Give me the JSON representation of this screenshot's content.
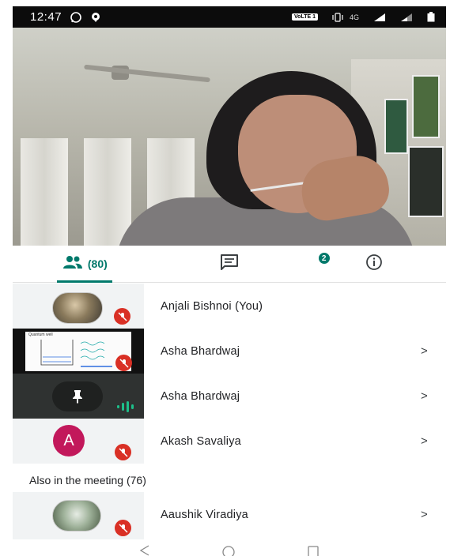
{
  "status_bar": {
    "time": "12:47",
    "carrier_badge": "VoLTE 1",
    "network": "4G",
    "icons": [
      "whatsapp-icon",
      "location-icon",
      "vibrate-icon",
      "signal-icon",
      "battery-icon"
    ]
  },
  "video": {
    "description_icon": "self-video-feed"
  },
  "tabs": {
    "people_count": "(80)",
    "chat_badge": "2",
    "icons": [
      "people-icon",
      "chat-icon",
      "info-icon"
    ]
  },
  "participants": [
    {
      "name": "Anjali Bishnoi (You)",
      "tile": "photo-avatar",
      "muted": true,
      "chevron": ""
    },
    {
      "name": "Asha Bhardwaj",
      "tile": "screen-share",
      "muted": true,
      "chevron": ">"
    },
    {
      "name": "Asha Bhardwaj",
      "tile": "pinned-speaking",
      "muted": false,
      "chevron": ">"
    },
    {
      "name": "Akash Savaliya",
      "tile": "letter-avatar",
      "avatar_letter": "A",
      "muted": true,
      "chevron": ">"
    }
  ],
  "also_in_meeting": {
    "label": "Also in the meeting (76)",
    "participants": [
      {
        "name": "Aaushik Viradiya",
        "tile": "photo-avatar",
        "muted": true,
        "chevron": ">"
      }
    ]
  },
  "screen_share_thumb_title": "Quantum well",
  "colors": {
    "accent": "#00796b",
    "mute_red": "#d93025",
    "avatar_magenta": "#c2185b",
    "speaking_green": "#1dbf8a"
  }
}
